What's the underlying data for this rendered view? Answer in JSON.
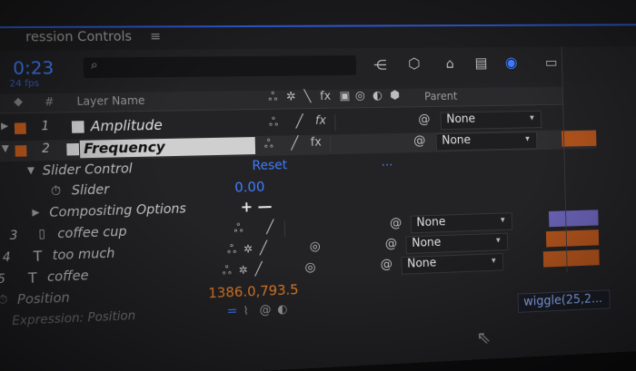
{
  "panel": {
    "title": "ression Controls",
    "menu_icon": "hamburger-menu-icon",
    "timecode": "0:23",
    "timecode_sub": "24 fps"
  },
  "columns": {
    "num": "#",
    "layer_name": "Layer Name",
    "parent": "Parent"
  },
  "layers": [
    {
      "num": "1",
      "name": "Amplitude",
      "parent": "None",
      "color": "#d0621f"
    },
    {
      "num": "2",
      "name": "Frequency",
      "parent": "None",
      "color": "#d0621f"
    },
    {
      "num": "3",
      "name": "coffee cup",
      "parent": "None",
      "color": "#8c86c8"
    },
    {
      "num": "4",
      "name": "too much",
      "parent": "None",
      "color": "#d0621f"
    },
    {
      "num": "5",
      "name": "coffee",
      "parent": "None",
      "color": "#d0621f"
    }
  ],
  "effect": {
    "name": "Slider Control",
    "reset": "Reset",
    "more": "...",
    "slider_label": "Slider",
    "slider_value": "0.00",
    "compositing": "Compositing Options",
    "comp_controls": "+ —"
  },
  "position": {
    "label": "Position",
    "value": "1386.0,793.5",
    "expr_label": "Expression: Position",
    "expr_text": "wiggle(25,2..."
  },
  "colors": {
    "accent": "#3f7dff",
    "orange": "#e07a25",
    "timeline_orange": "#b3541d",
    "timeline_purple": "#6b63b8"
  }
}
